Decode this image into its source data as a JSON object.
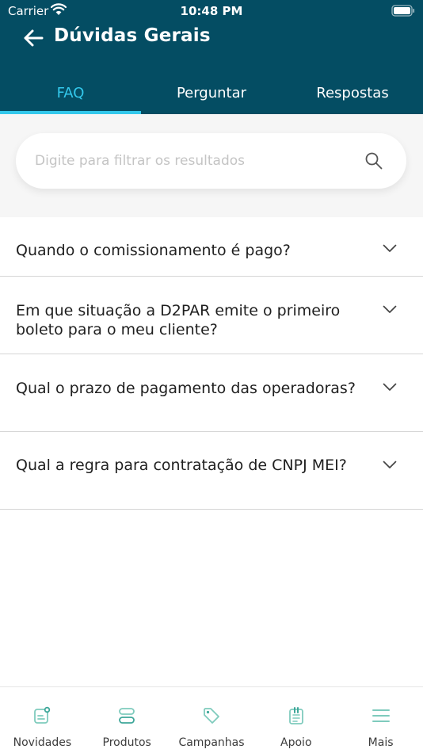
{
  "status_bar": {
    "carrier": "Carrier",
    "time": "10:48 PM"
  },
  "header": {
    "title": "Dúvidas Gerais"
  },
  "tabs": [
    {
      "label": "FAQ",
      "active": true
    },
    {
      "label": "Perguntar",
      "active": false
    },
    {
      "label": "Respostas",
      "active": false
    }
  ],
  "search": {
    "placeholder": "Digite para filtrar os resultados",
    "value": ""
  },
  "faq": [
    {
      "question": "Quando o comissionamento é pago?"
    },
    {
      "question": "Em que situação a D2PAR emite o primeiro boleto para o meu cliente?"
    },
    {
      "question": "Qual o prazo de pagamento das operadoras?"
    },
    {
      "question": "Qual a regra para contratação de CNPJ MEI?"
    }
  ],
  "bottom_nav": [
    {
      "label": "Novidades",
      "icon": "news-icon"
    },
    {
      "label": "Produtos",
      "icon": "products-icon"
    },
    {
      "label": "Campanhas",
      "icon": "tag-icon"
    },
    {
      "label": "Apoio",
      "icon": "clipboard-icon"
    },
    {
      "label": "Mais",
      "icon": "menu-icon"
    }
  ],
  "colors": {
    "header": "#044d63",
    "accent": "#33c8ec",
    "nav_icon": "#7fcbbd",
    "nav_icon_accent": "#3ea79a"
  }
}
